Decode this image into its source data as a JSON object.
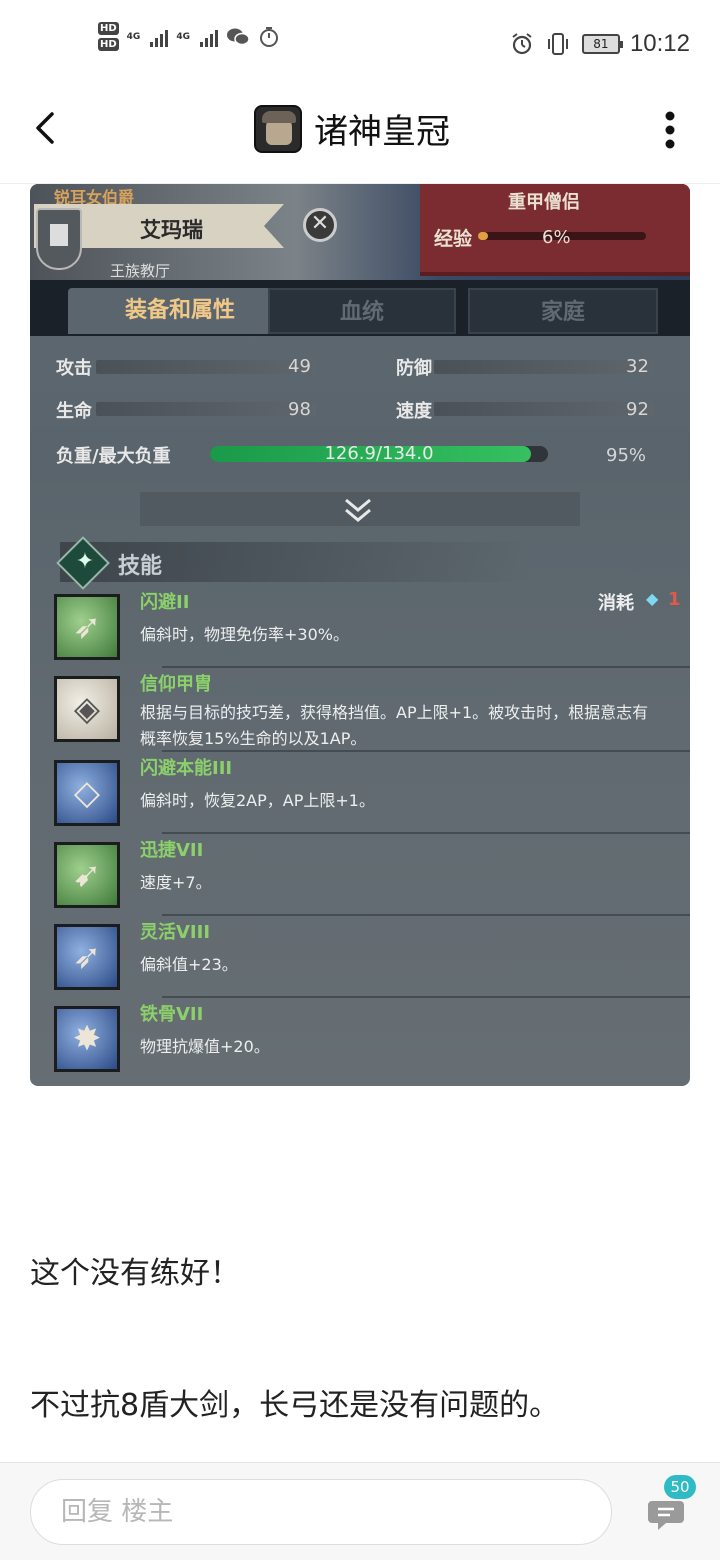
{
  "status_bar": {
    "hd1": "HD",
    "hd2": "HD",
    "net1": "4G",
    "net2": "4G",
    "battery": "81",
    "time": "10:12"
  },
  "nav": {
    "title": "诸神皇冠"
  },
  "game": {
    "rank": "锐耳女伯爵",
    "character_name": "艾玛瑞",
    "guild": "王族教厅",
    "class": "重甲僧侣",
    "exp_label": "经验",
    "exp_percent": "6%",
    "exp_fraction": 0.06,
    "tabs": [
      "装备和属性",
      "血统",
      "家庭"
    ],
    "stats": {
      "attack_label": "攻击",
      "attack": "49",
      "defense_label": "防御",
      "defense": "32",
      "hp_label": "生命",
      "hp": "98",
      "speed_label": "速度",
      "speed": "92",
      "load_label": "负重/最大负重",
      "load": "126.9/134.0",
      "load_pct": "95%",
      "load_fraction": 0.95
    },
    "skills_title": "技能",
    "cost_label": "消耗",
    "cost_value": "1",
    "skills": [
      {
        "name": "闪避II",
        "desc": "偏斜时，物理免伤率+30%。"
      },
      {
        "name": "信仰甲胄",
        "desc": "根据与目标的技巧差，获得格挡值。AP上限+1。被攻击时，根据意志有概率恢复15%生命的以及1AP。"
      },
      {
        "name": "闪避本能III",
        "desc": "偏斜时，恢复2AP，AP上限+1。"
      },
      {
        "name": "迅捷VII",
        "desc": "速度+7。"
      },
      {
        "name": "灵活VIII",
        "desc": "偏斜值+23。"
      },
      {
        "name": "铁骨VII",
        "desc": "物理抗爆值+20。"
      }
    ]
  },
  "post": {
    "line1": "这个没有练好！",
    "line2": "不过抗8盾大剑，长弓还是没有问题的。"
  },
  "reply": {
    "placeholder": "回复  楼主",
    "comment_count": "50"
  }
}
